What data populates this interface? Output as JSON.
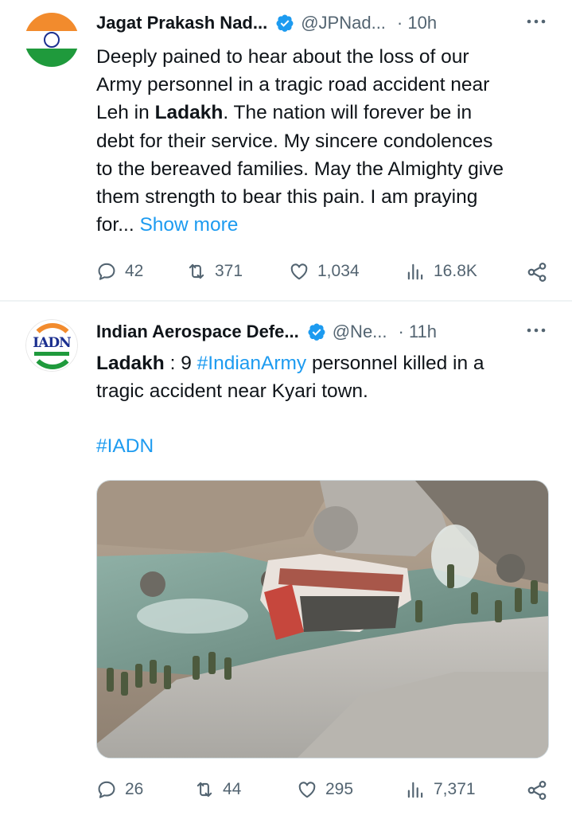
{
  "tweets": [
    {
      "name": "Jagat Prakash Nad...",
      "handle": "@JPNad...",
      "time": "· 10h",
      "body": {
        "line1": "Deeply pained to hear about the loss of our",
        "line2": "Army personnel in a tragic road accident near",
        "line3_pre": "Leh in ",
        "line3_bold": "Ladakh",
        "line3_post": ". The nation will forever be in",
        "line4": "debt for their service. My sincere condolences",
        "line5": "to the bereaved families. May the Almighty give",
        "line6": "them strength to bear this pain. I am praying",
        "line7_pre": "for... ",
        "show_more": "Show more"
      },
      "stats": {
        "replies": "42",
        "reposts": "371",
        "likes": "1,034",
        "views": "16.8K"
      }
    },
    {
      "name": "Indian Aerospace Defe...",
      "handle": "@Ne...",
      "time": "· 11h",
      "avatar_text": "IADN",
      "body": {
        "bold": "Ladakh",
        "mid": " : 9 ",
        "hashtag": "#IndianArmy",
        "rest": " personnel killed in a",
        "line2": "tragic accident near Kyari town.",
        "hashtag_line": "#IADN"
      },
      "stats": {
        "replies": "26",
        "reposts": "44",
        "likes": "295",
        "views": "7,371"
      }
    }
  ],
  "icons": {
    "verified": "verified-badge-icon",
    "more": "more-dots-icon",
    "reply": "reply-icon",
    "repost": "repost-icon",
    "like": "like-icon",
    "views": "views-icon",
    "share": "share-icon"
  },
  "colors": {
    "text": "#0f1419",
    "secondary": "#536471",
    "link": "#1d9bf0",
    "verified": "#1d9bf0"
  }
}
